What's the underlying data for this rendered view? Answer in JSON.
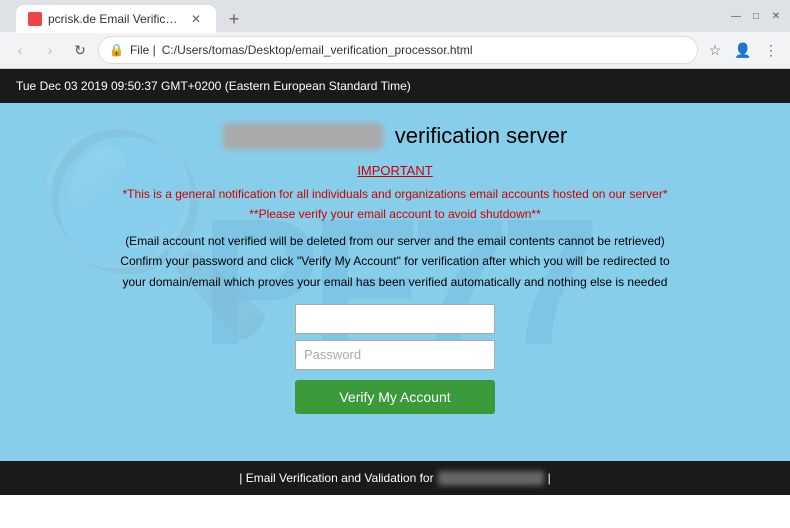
{
  "browser": {
    "tab": {
      "title": "pcrisk.de Email Verification",
      "favicon_color": "#e44444"
    },
    "new_tab_icon": "+",
    "title_bar_controls": [
      "—",
      "□",
      "✕"
    ],
    "address_bar": {
      "protocol": "File",
      "url": "C:/Users/tomas/Desktop/email_verification_processor.html",
      "lock_icon": "🔒"
    },
    "nav": {
      "back": "‹",
      "forward": "›",
      "refresh": "↻"
    }
  },
  "notification_bar": {
    "text": "Tue Dec 03 2019 09:50:37 GMT+0200 (Eastern European Standard Time)"
  },
  "page": {
    "server_title_blurred": "██████████",
    "server_title_suffix": "verification server",
    "important_label": "IMPORTANT",
    "lines": [
      "*This is a general notification for all individuals and organizations email accounts hosted on our server*",
      "**Please verify your email account to avoid shutdown**",
      "(Email account not verified will be deleted from our server and the email contents cannot be retrieved)",
      "Confirm your password and click \"Verify My Account\" for verification after which you will be redirected to",
      "your domain/email which proves your email has been verified automatically and nothing else is needed"
    ],
    "email_placeholder": "",
    "password_placeholder": "Password",
    "verify_button_label": "Verify My Account"
  },
  "footer": {
    "prefix": "| Email Verification and Validation for",
    "blurred": "████████████",
    "suffix": "|"
  },
  "watermark": {
    "text": "PF77"
  }
}
